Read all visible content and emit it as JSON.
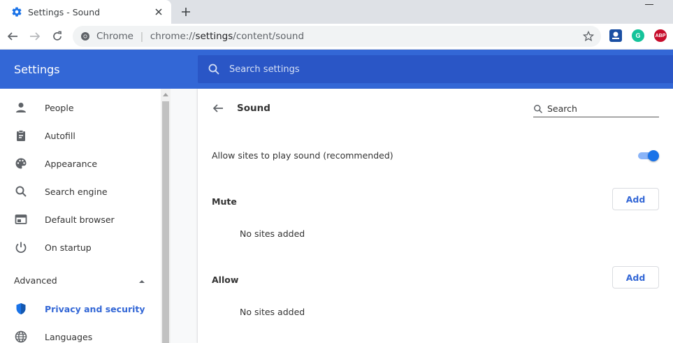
{
  "tab": {
    "title": "Settings - Sound"
  },
  "omnibox": {
    "chip": "Chrome",
    "url_prefix": "chrome://",
    "url_host": "settings",
    "url_path": "/content/sound"
  },
  "extensions": [
    {
      "name": "extension-ecosia-icon",
      "color": "#1a4fa3"
    },
    {
      "name": "extension-grammarly-icon",
      "color": "#15c39a",
      "text": "G"
    },
    {
      "name": "extension-adblock-plus-icon",
      "color": "#c70d2c",
      "text": "ABP"
    }
  ],
  "header": {
    "title": "Settings",
    "search_placeholder": "Search settings"
  },
  "sidebar": {
    "items": [
      {
        "label": "People",
        "icon": "person-icon"
      },
      {
        "label": "Autofill",
        "icon": "clipboard-icon"
      },
      {
        "label": "Appearance",
        "icon": "palette-icon"
      },
      {
        "label": "Search engine",
        "icon": "search-icon"
      },
      {
        "label": "Default browser",
        "icon": "browser-window-icon"
      },
      {
        "label": "On startup",
        "icon": "power-icon"
      }
    ],
    "advanced_label": "Advanced",
    "advanced_items": [
      {
        "label": "Privacy and security",
        "icon": "shield-icon",
        "active": true
      },
      {
        "label": "Languages",
        "icon": "globe-icon"
      }
    ]
  },
  "page": {
    "title": "Sound",
    "search_placeholder": "Search",
    "allow_sound_label": "Allow sites to play sound (recommended)",
    "allow_sound_enabled": true,
    "mute": {
      "heading": "Mute",
      "add_label": "Add",
      "empty_text": "No sites added"
    },
    "allow": {
      "heading": "Allow",
      "add_label": "Add",
      "empty_text": "No sites added"
    }
  },
  "colors": {
    "accent": "#3367d6",
    "header": "#3367d6",
    "search_bar": "#2a56c6",
    "toggle": "#1a73e8"
  }
}
